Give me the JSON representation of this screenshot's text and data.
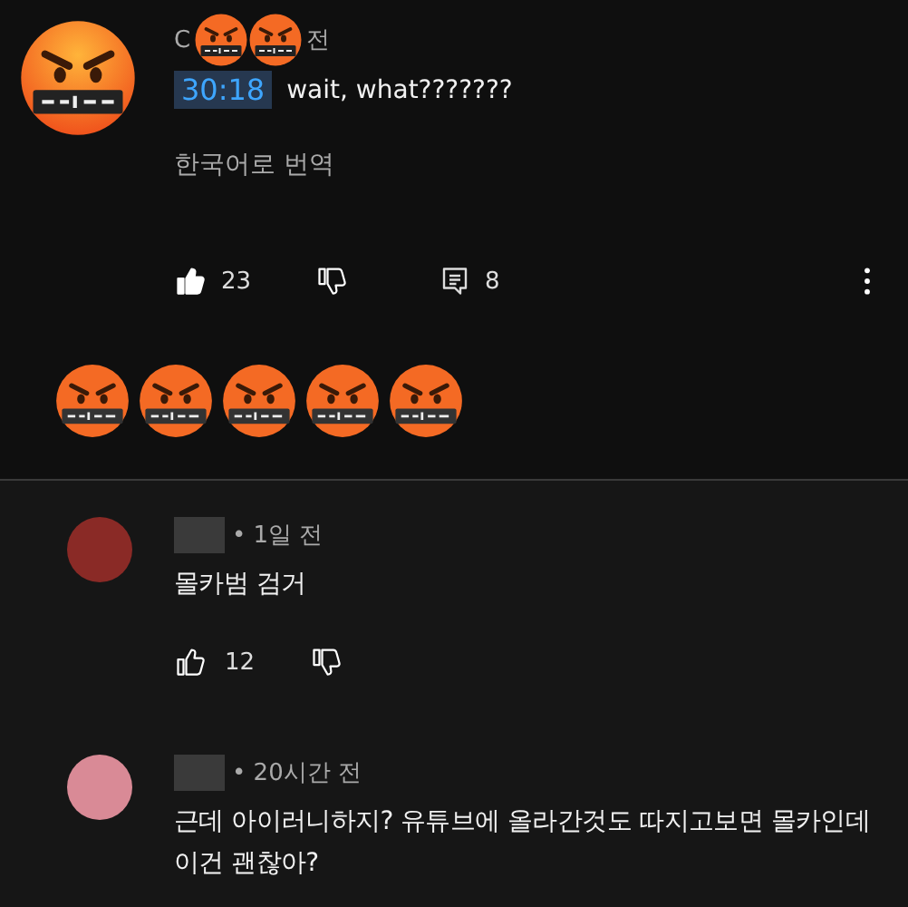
{
  "top_comment": {
    "author_visible": "C",
    "time_visible": "전",
    "stickers": [
      {
        "kind": "cursing-face"
      },
      {
        "kind": "cursing-face"
      }
    ],
    "timestamp": "30:18",
    "text": "wait, what???????",
    "translate": "한국어로 번역",
    "likes": "23",
    "liked": true,
    "replies": "8"
  },
  "sticker_row": [
    {
      "kind": "cursing-face"
    },
    {
      "kind": "cursing-face"
    },
    {
      "kind": "cursing-face"
    },
    {
      "kind": "cursing-face"
    },
    {
      "kind": "cursing-face"
    }
  ],
  "replies": [
    {
      "color": "#8a2a26",
      "time": "• 1일 전",
      "text": "몰카범 검거",
      "likes": "12",
      "liked": false
    },
    {
      "color": "#d98a96",
      "time": "• 20시간 전",
      "text": "근데 아이러니하지? 유튜브에 올라간것도 따지고보면 몰카인데 이건 괜찮아?"
    }
  ]
}
